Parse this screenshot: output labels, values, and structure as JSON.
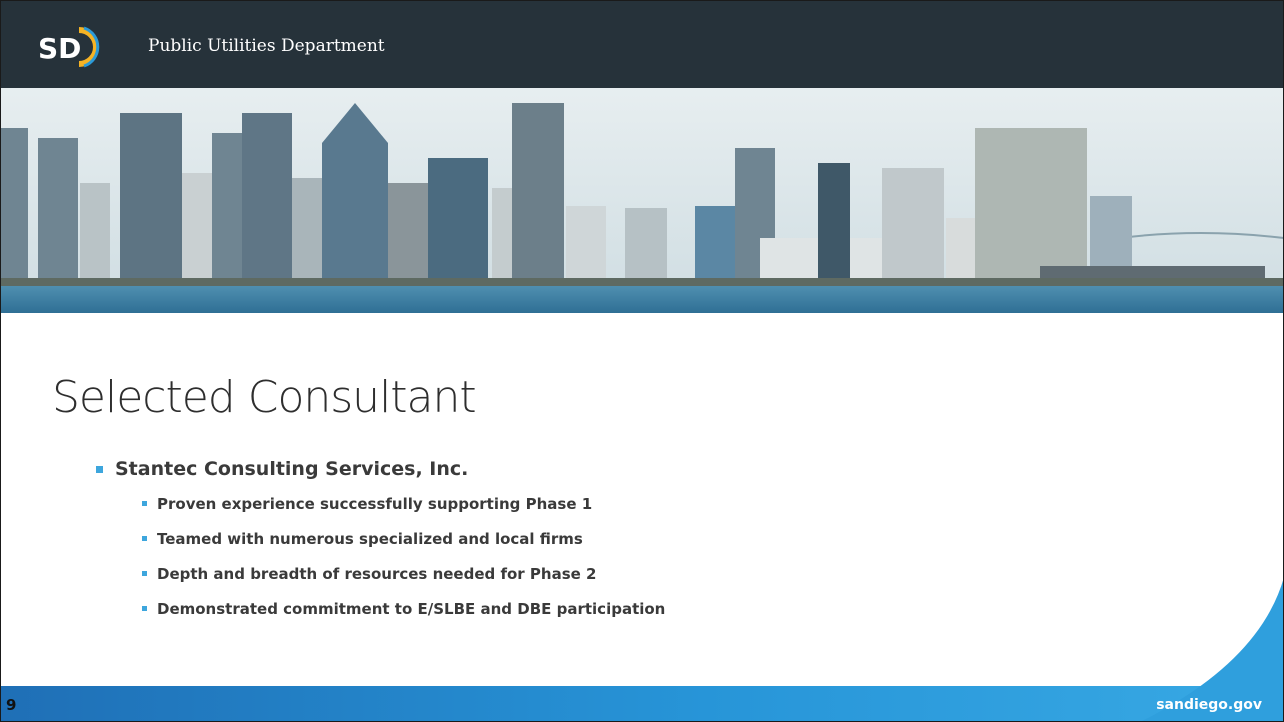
{
  "header": {
    "logo_text": "SD",
    "department": "Public Utilities Department"
  },
  "slide": {
    "title": "Selected Consultant",
    "bullets": [
      {
        "text": "Stantec Consulting Services, Inc.",
        "sub": [
          "Proven experience successfully supporting Phase 1",
          "Teamed with numerous specialized and local firms",
          "Depth and breadth of resources needed for Phase 2",
          "Demonstrated commitment to E/SLBE and DBE participation"
        ]
      }
    ]
  },
  "footer": {
    "page_number": "9",
    "website": "sandiego.gov"
  },
  "colors": {
    "header_bg": "#26323a",
    "accent_blue": "#3da6dd",
    "footer_blue": "#2795d8",
    "logo_gold": "#f5b324"
  },
  "icons": [
    "city-of-san-diego-logo",
    "skyline-photo",
    "bullet-square-icon"
  ]
}
